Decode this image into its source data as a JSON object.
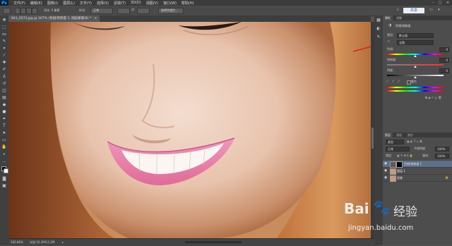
{
  "app": {
    "logo": "Ps"
  },
  "menubar": {
    "items": [
      "文件(F)",
      "编辑(E)",
      "图像(I)",
      "图层(L)",
      "文字(Y)",
      "选择(S)",
      "滤镜(T)",
      "3D(D)",
      "视图(V)",
      "窗口(W)",
      "帮助(H)"
    ]
  },
  "options": {
    "feather_label": "羽化: 0 像素",
    "style_label": "样式:",
    "style_value": "正常",
    "select_mask_label": "选择并遮住...",
    "share_label": "共享"
  },
  "document": {
    "tab_title": "841_0573.jpg @ 167% (色相/饱和度 1, 图层蒙版/8) *",
    "tab_close": "×",
    "zoom": "166.86%",
    "doc_info": "文档:10.2M/11.2M"
  },
  "properties_panel": {
    "tabs": [
      "属性",
      "调整"
    ],
    "title": "色相/饱和度",
    "preset_label": "预设:",
    "preset_value": "默认值",
    "channel_value": "全图",
    "hue_label": "色相:",
    "hue_value": "0",
    "saturation_label": "饱和度:",
    "saturation_value": "0",
    "lightness_label": "明度:",
    "lightness_value": "0",
    "colorize_label": "着色",
    "hue_level": 0.5,
    "saturation_level": 0.5,
    "lightness_level": 0.5
  },
  "layers_panel": {
    "tabs": [
      "图层",
      "通道",
      "路径"
    ],
    "kind_label": "类型",
    "blend_mode": "正常",
    "opacity_label": "不透明度:",
    "opacity_value": "100%",
    "lock_label": "锁定:",
    "fill_label": "填充:",
    "fill_value": "100%",
    "layers": [
      {
        "name": "色相/饱和度 1",
        "active": true
      },
      {
        "name": "图层 1",
        "active": false
      },
      {
        "name": "背景",
        "active": false
      }
    ]
  },
  "watermark": {
    "brand": "Bai",
    "brand_suffix": "经验",
    "url": "jingyan.baidu.com"
  },
  "colors": {
    "accent_arrow": "#e02020",
    "active_layer": "#5d6f8a",
    "lip_pink": "#e4739f"
  }
}
